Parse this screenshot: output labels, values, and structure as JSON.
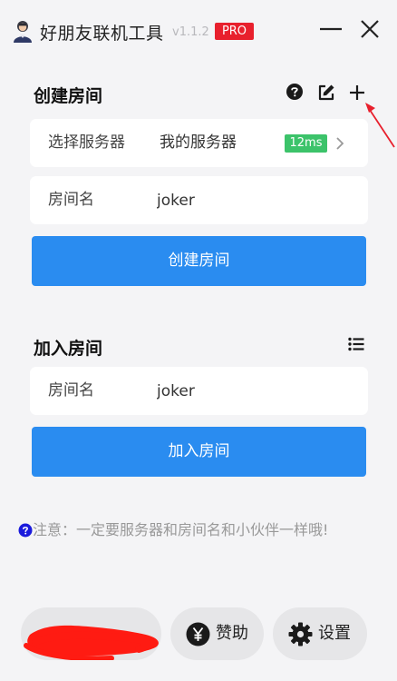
{
  "app": {
    "title": "好朋友联机工具",
    "version": "v1.1.2",
    "badge": "PRO"
  },
  "create_room": {
    "title": "创建房间",
    "server_row": {
      "label": "选择服务器",
      "value": "我的服务器",
      "ping": "12ms"
    },
    "room_name_row": {
      "label": "房间名",
      "value": "joker"
    },
    "submit_label": "创建房间"
  },
  "join_room": {
    "title": "加入房间",
    "room_name_row": {
      "label": "房间名",
      "value": "joker"
    },
    "submit_label": "加入房间"
  },
  "notice": {
    "text": "注意：一定要服务器和房间名和小伙伴一样哦!"
  },
  "bottom_bar": {
    "sponsor_label": "赞助",
    "settings_label": "设置"
  },
  "colors": {
    "primary": "#2a8cf0",
    "pro_badge": "#e8202d",
    "ping_badge": "#3cc36a",
    "notice_icon": "#1a1adc",
    "annotation": "#e8202d"
  },
  "icons": {
    "help": "question-circle-icon",
    "edit": "edit-icon",
    "add": "plus-icon",
    "list": "list-icon",
    "sponsor": "yen-coin-icon",
    "settings": "gear-icon"
  }
}
